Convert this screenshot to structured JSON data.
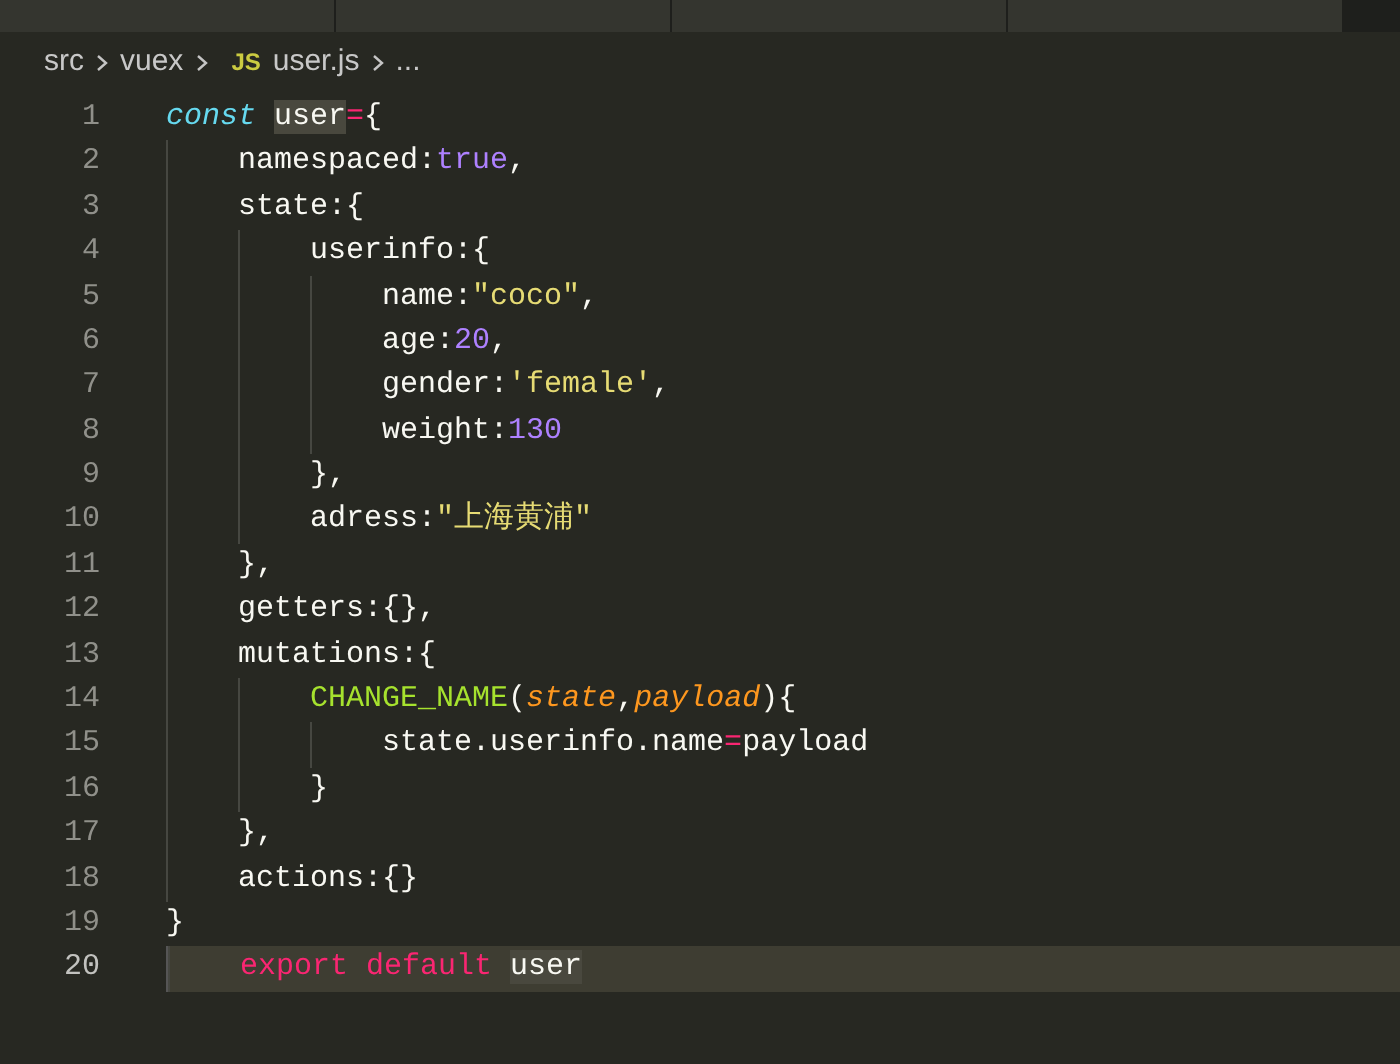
{
  "tabs": [
    {
      "selected": false
    },
    {
      "selected": false
    },
    {
      "selected": false
    },
    {
      "selected": false
    }
  ],
  "breadcrumb": [
    {
      "kind": "folder",
      "label": "src"
    },
    {
      "kind": "folder",
      "label": "vuex"
    },
    {
      "kind": "file",
      "icon": "JS",
      "label": "user.js"
    },
    {
      "kind": "more",
      "label": "..."
    }
  ],
  "lines": [
    {
      "number": "1",
      "current": false,
      "tokens": [
        {
          "kind": "storage",
          "text": "const "
        },
        {
          "kind": "match",
          "text": "user"
        },
        {
          "kind": "operator",
          "text": "="
        },
        {
          "kind": "plain",
          "text": "{"
        }
      ]
    },
    {
      "number": "2",
      "current": false,
      "tokens": [
        {
          "kind": "plain",
          "text": "    namespaced:"
        },
        {
          "kind": "constant",
          "text": "true"
        },
        {
          "kind": "plain",
          "text": ","
        }
      ]
    },
    {
      "number": "3",
      "current": false,
      "tokens": [
        {
          "kind": "plain",
          "text": "    state:{"
        }
      ]
    },
    {
      "number": "4",
      "current": false,
      "tokens": [
        {
          "kind": "plain",
          "text": "        userinfo:{"
        }
      ]
    },
    {
      "number": "5",
      "current": false,
      "tokens": [
        {
          "kind": "plain",
          "text": "            name:"
        },
        {
          "kind": "string",
          "text": "\"coco\""
        },
        {
          "kind": "plain",
          "text": ","
        }
      ]
    },
    {
      "number": "6",
      "current": false,
      "tokens": [
        {
          "kind": "plain",
          "text": "            age:"
        },
        {
          "kind": "constant",
          "text": "20"
        },
        {
          "kind": "plain",
          "text": ","
        }
      ]
    },
    {
      "number": "7",
      "current": false,
      "tokens": [
        {
          "kind": "plain",
          "text": "            gender:"
        },
        {
          "kind": "string",
          "text": "'female'"
        },
        {
          "kind": "plain",
          "text": ","
        }
      ]
    },
    {
      "number": "8",
      "current": false,
      "tokens": [
        {
          "kind": "plain",
          "text": "            weight:"
        },
        {
          "kind": "constant",
          "text": "130"
        }
      ]
    },
    {
      "number": "9",
      "current": false,
      "tokens": [
        {
          "kind": "plain",
          "text": "        },"
        }
      ]
    },
    {
      "number": "10",
      "current": false,
      "tokens": [
        {
          "kind": "plain",
          "text": "        adress:"
        },
        {
          "kind": "string",
          "text": "\"上海黄浦\""
        }
      ]
    },
    {
      "number": "11",
      "current": false,
      "tokens": [
        {
          "kind": "plain",
          "text": "    },"
        }
      ]
    },
    {
      "number": "12",
      "current": false,
      "tokens": [
        {
          "kind": "plain",
          "text": "    getters:{},"
        }
      ]
    },
    {
      "number": "13",
      "current": false,
      "tokens": [
        {
          "kind": "plain",
          "text": "    mutations:{"
        }
      ]
    },
    {
      "number": "14",
      "current": false,
      "tokens": [
        {
          "kind": "function",
          "text": "        CHANGE_NAME"
        },
        {
          "kind": "plain",
          "text": "("
        },
        {
          "kind": "parameter",
          "text": "state"
        },
        {
          "kind": "plain",
          "text": ","
        },
        {
          "kind": "parameter",
          "text": "payload"
        },
        {
          "kind": "plain",
          "text": "){"
        }
      ]
    },
    {
      "number": "15",
      "current": false,
      "tokens": [
        {
          "kind": "plain",
          "text": "            state.userinfo.name"
        },
        {
          "kind": "operator",
          "text": "="
        },
        {
          "kind": "plain",
          "text": "payload"
        }
      ]
    },
    {
      "number": "16",
      "current": false,
      "tokens": [
        {
          "kind": "plain",
          "text": "        }"
        }
      ]
    },
    {
      "number": "17",
      "current": false,
      "tokens": [
        {
          "kind": "plain",
          "text": "    },"
        }
      ]
    },
    {
      "number": "18",
      "current": false,
      "tokens": [
        {
          "kind": "plain",
          "text": "    actions:{}"
        }
      ]
    },
    {
      "number": "19",
      "current": false,
      "tokens": [
        {
          "kind": "plain",
          "text": "}"
        }
      ]
    },
    {
      "number": "20",
      "current": true,
      "tokens": [
        {
          "kind": "keyword",
          "text": "    export default "
        },
        {
          "kind": "match",
          "text": "user"
        }
      ]
    }
  ]
}
